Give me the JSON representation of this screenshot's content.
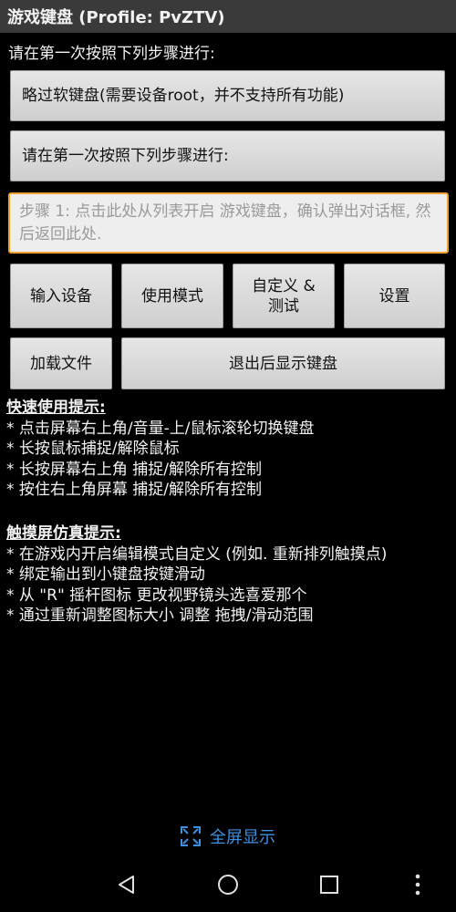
{
  "titlebar": {
    "title": "游戏键盘 (Profile: PvZTV)"
  },
  "instruction": "请在第一次按照下列步骤进行:",
  "buttons": {
    "skip_soft_keyboard": "略过软键盘(需要设备root，并不支持所有功能)",
    "first_time_steps": "请在第一次按照下列步骤进行:",
    "input_device": "输入设备",
    "usage_mode": "使用模式",
    "customize_test_line1": "自定义 &",
    "customize_test_line2": "测试",
    "settings": "设置",
    "load_file": "加载文件",
    "show_keyboard_after_exit": "退出后显示键盘"
  },
  "step_box": {
    "text": "步骤 1: 点击此处从列表开启 游戏键盘，确认弹出对话框, 然后返回此处."
  },
  "quick_tips": {
    "heading": "快速使用提示:",
    "items": [
      "* 点击屏幕右上角/音量-上/鼠标滚轮切换键盘",
      "* 长按鼠标捕捉/解除鼠标",
      "* 长按屏幕右上角 捕捉/解除所有控制",
      "* 按住右上角屏幕 捕捉/解除所有控制"
    ]
  },
  "touch_tips": {
    "heading": "触摸屏仿真提示:",
    "items": [
      "* 在游戏内开启编辑模式自定义 (例如. 重新排列触摸点)",
      "* 绑定输出到小键盘按键滑动",
      "* 从 \"R\" 摇杆图标 更改视野镜头选喜爱那个",
      "* 通过重新调整图标大小 调整 拖拽/滑动范围"
    ]
  },
  "fullscreen": {
    "label": "全屏显示",
    "icon": "fullscreen-expand-icon",
    "color": "#3d8fe0"
  },
  "navbar": {
    "back_icon": "back-triangle-icon",
    "home_icon": "home-circle-icon",
    "recents_icon": "recents-square-icon",
    "menu_icon": "overflow-menu-icon"
  }
}
